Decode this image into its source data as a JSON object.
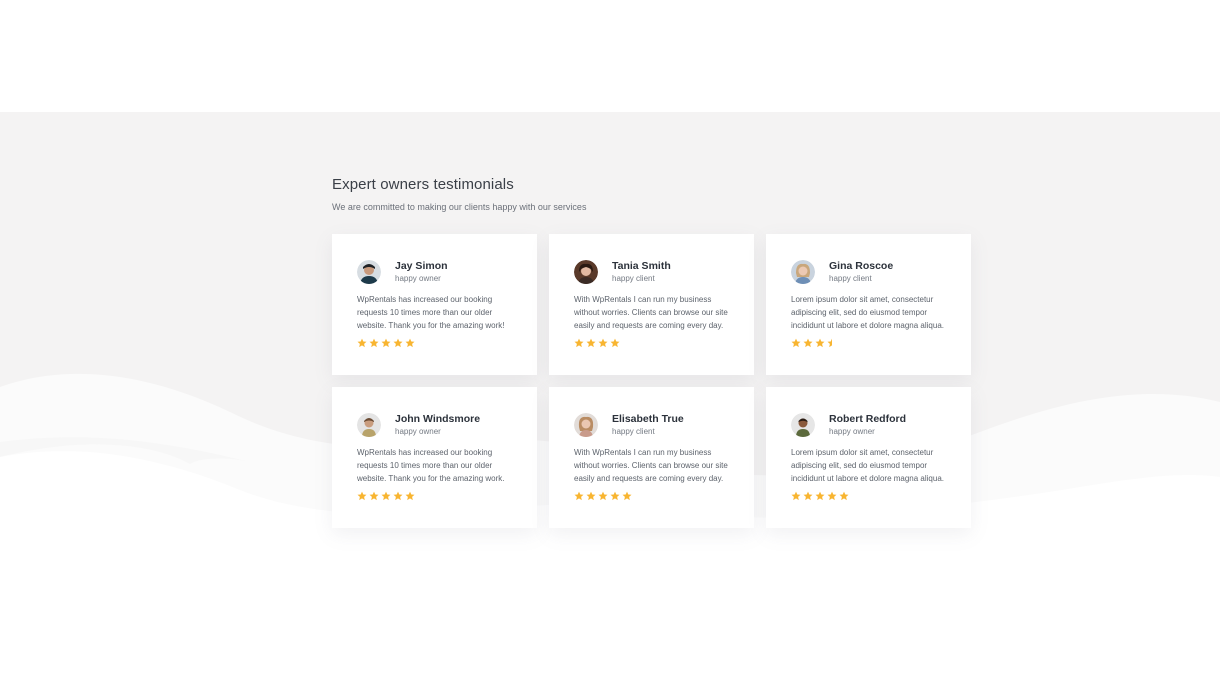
{
  "section": {
    "title": "Expert owners testimonials",
    "subtitle": "We are committed to making our clients happy with our services"
  },
  "colors": {
    "background": "#f4f3f3",
    "card": "#ffffff",
    "star": "#f8b531",
    "title": "#3a3f47",
    "body_text": "#5d636c"
  },
  "testimonials": [
    {
      "name": "Jay Simon",
      "role": "happy owner",
      "quote": "WpRentals has increased our booking requests 10 times more than our older website. Thank you for the amazing work!",
      "rating": 5,
      "avatar_icon": "avatar-photo-icon"
    },
    {
      "name": "Tania Smith",
      "role": "happy client",
      "quote": "With WpRentals I can run my business without worries. Clients can browse our site easily and requests are coming every day.",
      "rating": 4,
      "avatar_icon": "avatar-photo-icon"
    },
    {
      "name": "Gina Roscoe",
      "role": "happy client",
      "quote": "Lorem ipsum dolor sit amet, consectetur adipiscing elit, sed do eiusmod tempor incididunt ut labore et dolore magna aliqua.",
      "rating": 3.5,
      "avatar_icon": "avatar-photo-icon"
    },
    {
      "name": "John Windsmore",
      "role": "happy owner",
      "quote": "WpRentals has increased our booking requests 10 times more than our older website. Thank you for the amazing work.",
      "rating": 5,
      "avatar_icon": "avatar-photo-icon"
    },
    {
      "name": "Elisabeth True",
      "role": "happy client",
      "quote": "With WpRentals I can run my business without worries. Clients can browse our site easily and requests are coming every day.",
      "rating": 5,
      "avatar_icon": "avatar-photo-icon"
    },
    {
      "name": "Robert Redford",
      "role": "happy owner",
      "quote": "Lorem ipsum dolor sit amet, consectetur adipiscing elit, sed do eiusmod tempor incididunt ut labore et dolore magna aliqua.",
      "rating": 5,
      "avatar_icon": "avatar-photo-icon"
    }
  ]
}
